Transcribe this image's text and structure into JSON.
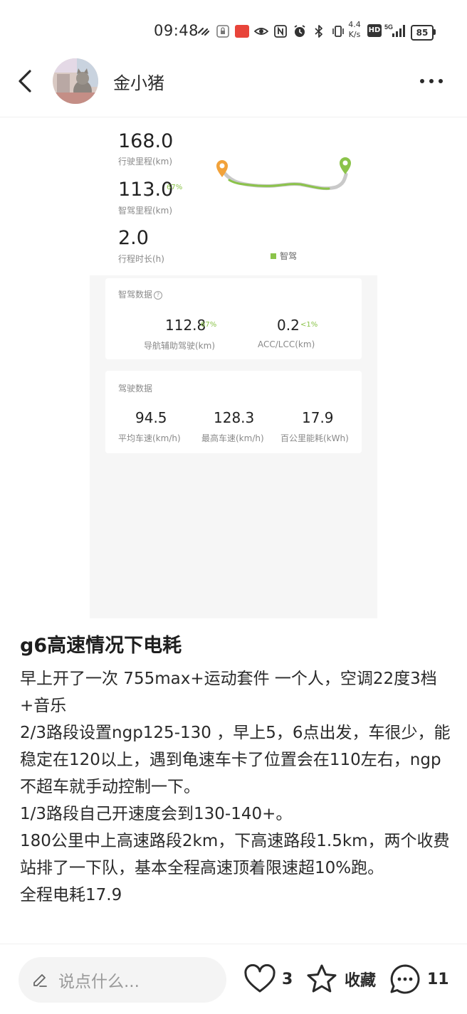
{
  "status_bar": {
    "time": "09:48",
    "net_speed_value": "4.4",
    "net_speed_unit": "K/s",
    "hd": "HD",
    "signal": "5G",
    "battery": "85"
  },
  "header": {
    "author_name": "金小猪"
  },
  "trip_image": {
    "distance_value": "168.0",
    "distance_label": "行驶里程(km)",
    "smart_value": "113.0",
    "smart_pct": "67%",
    "smart_label": "智驾里程(km)",
    "duration_value": "2.0",
    "duration_label": "行程时长(h)",
    "legend_label": "智驾",
    "smart_data": {
      "title": "智驾数据",
      "ngp_value": "112.8",
      "ngp_pct": "67%",
      "ngp_label": "导航辅助驾驶(km)",
      "acc_value": "0.2",
      "acc_pct": "<1%",
      "acc_label": "ACC/LCC(km)"
    },
    "drive_data": {
      "title": "驾驶数据",
      "avg_value": "94.5",
      "avg_label": "平均车速(km/h)",
      "max_value": "128.3",
      "max_label": "最高车速(km/h)",
      "energy_value": "17.9",
      "energy_label": "百公里能耗(kWh)"
    },
    "colors": {
      "accent_green": "#8bc34a",
      "start_orange": "#f2a23a"
    }
  },
  "post": {
    "title": "g6高速情况下电耗",
    "lines": [
      "早上开了一次 755max+运动套件 一个人，空调22度3档 +音乐",
      "2/3路段设置ngp125-130 ，早上5，6点出发，车很少，能稳定在120以上，遇到龟速车卡了位置会在110左右，ngp不超车就手动控制一下。",
      "1/3路段自己开速度会到130-140+。",
      "180公里中上高速路段2km，下高速路段1.5km，两个收费站排了一下队，基本全程高速顶着限速超10%跑。",
      "全程电耗17.9"
    ]
  },
  "bottom_bar": {
    "comment_placeholder": "说点什么...",
    "like_count": "3",
    "collect_label": "收藏",
    "comment_count": "11"
  }
}
